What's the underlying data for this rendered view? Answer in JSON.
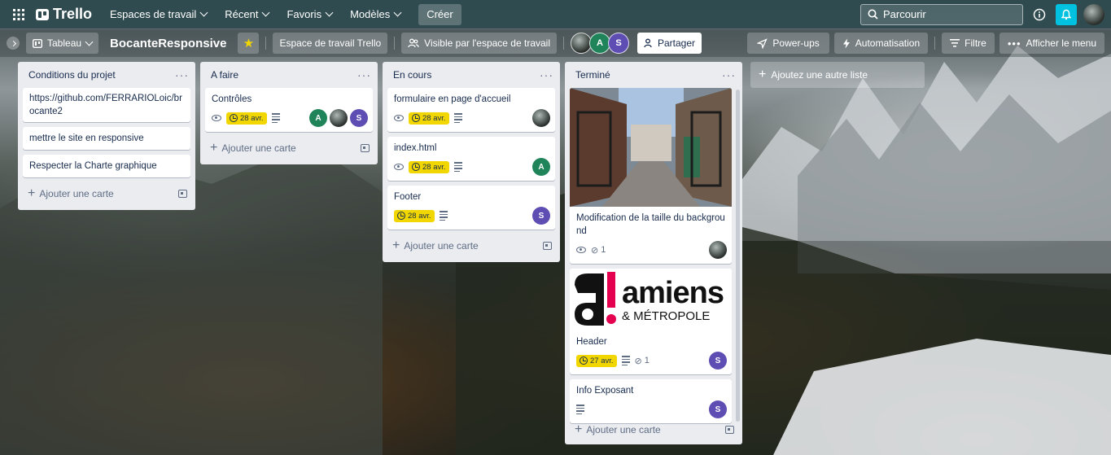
{
  "topbar": {
    "app_name": "Trello",
    "menus": [
      "Espaces de travail",
      "Récent",
      "Favoris",
      "Modèles"
    ],
    "create_label": "Créer",
    "search_placeholder": "Parcourir"
  },
  "board": {
    "view_label": "Tableau",
    "title": "BocanteResponsive",
    "workspace_label": "Espace de travail Trello",
    "visibility_label": "Visible par l'espace de travail",
    "members": [
      "A",
      "S"
    ],
    "share_label": "Partager",
    "powerups_label": "Power-ups",
    "automation_label": "Automatisation",
    "filter_label": "Filtre",
    "menu_label": "Afficher le menu"
  },
  "colors": {
    "accent_due": "#f2d600",
    "member_green": "#1f845a",
    "member_purple": "#5e4db2",
    "notification": "#00c2e0"
  },
  "lists": [
    {
      "title": "Conditions du projet",
      "cards": [
        {
          "title": "https://github.com/FERRARIOLoic/brocante2"
        },
        {
          "title": "mettre le site en responsive"
        },
        {
          "title": "Respecter la Charte graphique"
        }
      ],
      "add_label": "Ajouter une carte"
    },
    {
      "title": "A faire",
      "cards": [
        {
          "title": "Contrôles",
          "due": "28 avr."
        }
      ],
      "add_label": "Ajouter une carte"
    },
    {
      "title": "En cours",
      "cards": [
        {
          "title": "formulaire en page d'accueil",
          "due": "28 avr."
        },
        {
          "title": "index.html",
          "due": "28 avr."
        },
        {
          "title": "Footer",
          "due": "28 avr."
        }
      ],
      "add_label": "Ajouter une carte"
    },
    {
      "title": "Terminé",
      "cards": [
        {
          "title": "Modification de la taille du background",
          "attachments": "1"
        },
        {
          "title": "Header",
          "due": "27 avr.",
          "attachments": "1",
          "logo_text": "amiens",
          "logo_sub": "& MÉTROPOLE"
        },
        {
          "title": "Info Exposant"
        }
      ],
      "add_label": "Ajouter une carte"
    }
  ],
  "add_list_label": "Ajoutez une autre liste"
}
